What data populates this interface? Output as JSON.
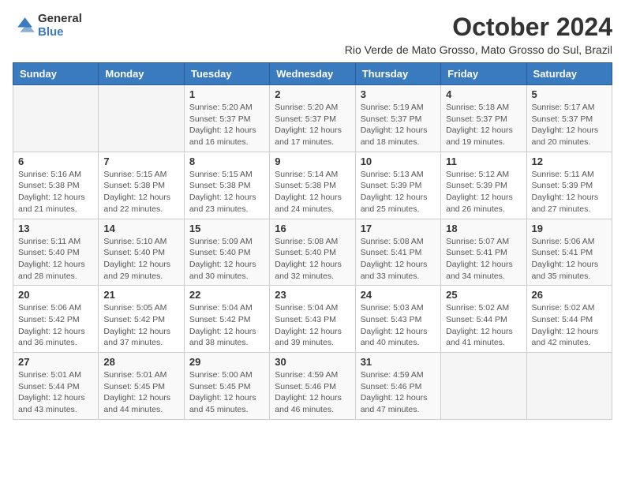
{
  "logo": {
    "general": "General",
    "blue": "Blue"
  },
  "title": "October 2024",
  "location": "Rio Verde de Mato Grosso, Mato Grosso do Sul, Brazil",
  "days_of_week": [
    "Sunday",
    "Monday",
    "Tuesday",
    "Wednesday",
    "Thursday",
    "Friday",
    "Saturday"
  ],
  "weeks": [
    [
      {
        "day": "",
        "info": ""
      },
      {
        "day": "",
        "info": ""
      },
      {
        "day": "1",
        "info": "Sunrise: 5:20 AM\nSunset: 5:37 PM\nDaylight: 12 hours and 16 minutes."
      },
      {
        "day": "2",
        "info": "Sunrise: 5:20 AM\nSunset: 5:37 PM\nDaylight: 12 hours and 17 minutes."
      },
      {
        "day": "3",
        "info": "Sunrise: 5:19 AM\nSunset: 5:37 PM\nDaylight: 12 hours and 18 minutes."
      },
      {
        "day": "4",
        "info": "Sunrise: 5:18 AM\nSunset: 5:37 PM\nDaylight: 12 hours and 19 minutes."
      },
      {
        "day": "5",
        "info": "Sunrise: 5:17 AM\nSunset: 5:37 PM\nDaylight: 12 hours and 20 minutes."
      }
    ],
    [
      {
        "day": "6",
        "info": "Sunrise: 5:16 AM\nSunset: 5:38 PM\nDaylight: 12 hours and 21 minutes."
      },
      {
        "day": "7",
        "info": "Sunrise: 5:15 AM\nSunset: 5:38 PM\nDaylight: 12 hours and 22 minutes."
      },
      {
        "day": "8",
        "info": "Sunrise: 5:15 AM\nSunset: 5:38 PM\nDaylight: 12 hours and 23 minutes."
      },
      {
        "day": "9",
        "info": "Sunrise: 5:14 AM\nSunset: 5:38 PM\nDaylight: 12 hours and 24 minutes."
      },
      {
        "day": "10",
        "info": "Sunrise: 5:13 AM\nSunset: 5:39 PM\nDaylight: 12 hours and 25 minutes."
      },
      {
        "day": "11",
        "info": "Sunrise: 5:12 AM\nSunset: 5:39 PM\nDaylight: 12 hours and 26 minutes."
      },
      {
        "day": "12",
        "info": "Sunrise: 5:11 AM\nSunset: 5:39 PM\nDaylight: 12 hours and 27 minutes."
      }
    ],
    [
      {
        "day": "13",
        "info": "Sunrise: 5:11 AM\nSunset: 5:40 PM\nDaylight: 12 hours and 28 minutes."
      },
      {
        "day": "14",
        "info": "Sunrise: 5:10 AM\nSunset: 5:40 PM\nDaylight: 12 hours and 29 minutes."
      },
      {
        "day": "15",
        "info": "Sunrise: 5:09 AM\nSunset: 5:40 PM\nDaylight: 12 hours and 30 minutes."
      },
      {
        "day": "16",
        "info": "Sunrise: 5:08 AM\nSunset: 5:40 PM\nDaylight: 12 hours and 32 minutes."
      },
      {
        "day": "17",
        "info": "Sunrise: 5:08 AM\nSunset: 5:41 PM\nDaylight: 12 hours and 33 minutes."
      },
      {
        "day": "18",
        "info": "Sunrise: 5:07 AM\nSunset: 5:41 PM\nDaylight: 12 hours and 34 minutes."
      },
      {
        "day": "19",
        "info": "Sunrise: 5:06 AM\nSunset: 5:41 PM\nDaylight: 12 hours and 35 minutes."
      }
    ],
    [
      {
        "day": "20",
        "info": "Sunrise: 5:06 AM\nSunset: 5:42 PM\nDaylight: 12 hours and 36 minutes."
      },
      {
        "day": "21",
        "info": "Sunrise: 5:05 AM\nSunset: 5:42 PM\nDaylight: 12 hours and 37 minutes."
      },
      {
        "day": "22",
        "info": "Sunrise: 5:04 AM\nSunset: 5:42 PM\nDaylight: 12 hours and 38 minutes."
      },
      {
        "day": "23",
        "info": "Sunrise: 5:04 AM\nSunset: 5:43 PM\nDaylight: 12 hours and 39 minutes."
      },
      {
        "day": "24",
        "info": "Sunrise: 5:03 AM\nSunset: 5:43 PM\nDaylight: 12 hours and 40 minutes."
      },
      {
        "day": "25",
        "info": "Sunrise: 5:02 AM\nSunset: 5:44 PM\nDaylight: 12 hours and 41 minutes."
      },
      {
        "day": "26",
        "info": "Sunrise: 5:02 AM\nSunset: 5:44 PM\nDaylight: 12 hours and 42 minutes."
      }
    ],
    [
      {
        "day": "27",
        "info": "Sunrise: 5:01 AM\nSunset: 5:44 PM\nDaylight: 12 hours and 43 minutes."
      },
      {
        "day": "28",
        "info": "Sunrise: 5:01 AM\nSunset: 5:45 PM\nDaylight: 12 hours and 44 minutes."
      },
      {
        "day": "29",
        "info": "Sunrise: 5:00 AM\nSunset: 5:45 PM\nDaylight: 12 hours and 45 minutes."
      },
      {
        "day": "30",
        "info": "Sunrise: 4:59 AM\nSunset: 5:46 PM\nDaylight: 12 hours and 46 minutes."
      },
      {
        "day": "31",
        "info": "Sunrise: 4:59 AM\nSunset: 5:46 PM\nDaylight: 12 hours and 47 minutes."
      },
      {
        "day": "",
        "info": ""
      },
      {
        "day": "",
        "info": ""
      }
    ]
  ]
}
